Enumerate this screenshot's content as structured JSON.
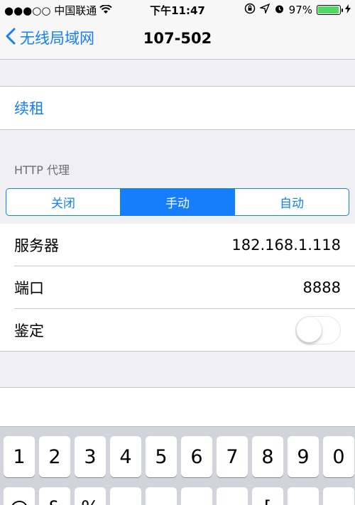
{
  "status_bar": {
    "carrier": "●●●○○ 中国联通",
    "time": "下午11:47",
    "battery_percent": "97%",
    "battery_level": 0.97
  },
  "nav": {
    "back_label": "无线局域网",
    "title": "107-502"
  },
  "lease": {
    "label": "续租"
  },
  "proxy": {
    "header": "HTTP 代理",
    "segments": [
      "关闭",
      "手动",
      "自动"
    ],
    "selected": "手动"
  },
  "fields": {
    "server_label": "服务器",
    "server_value": "182.168.1.118",
    "port_label": "端口",
    "port_value": "8888",
    "auth_label": "鉴定",
    "auth_on": false
  },
  "keyboard": {
    "row1": [
      "1",
      "2",
      "3",
      "4",
      "5",
      "6",
      "7",
      "8",
      "9",
      "0"
    ],
    "row2": [
      "@",
      "&",
      "%",
      "",
      "",
      "",
      "",
      "[",
      "",
      ""
    ]
  },
  "colors": {
    "accent": "#157efb",
    "battery": "#4cd964"
  }
}
